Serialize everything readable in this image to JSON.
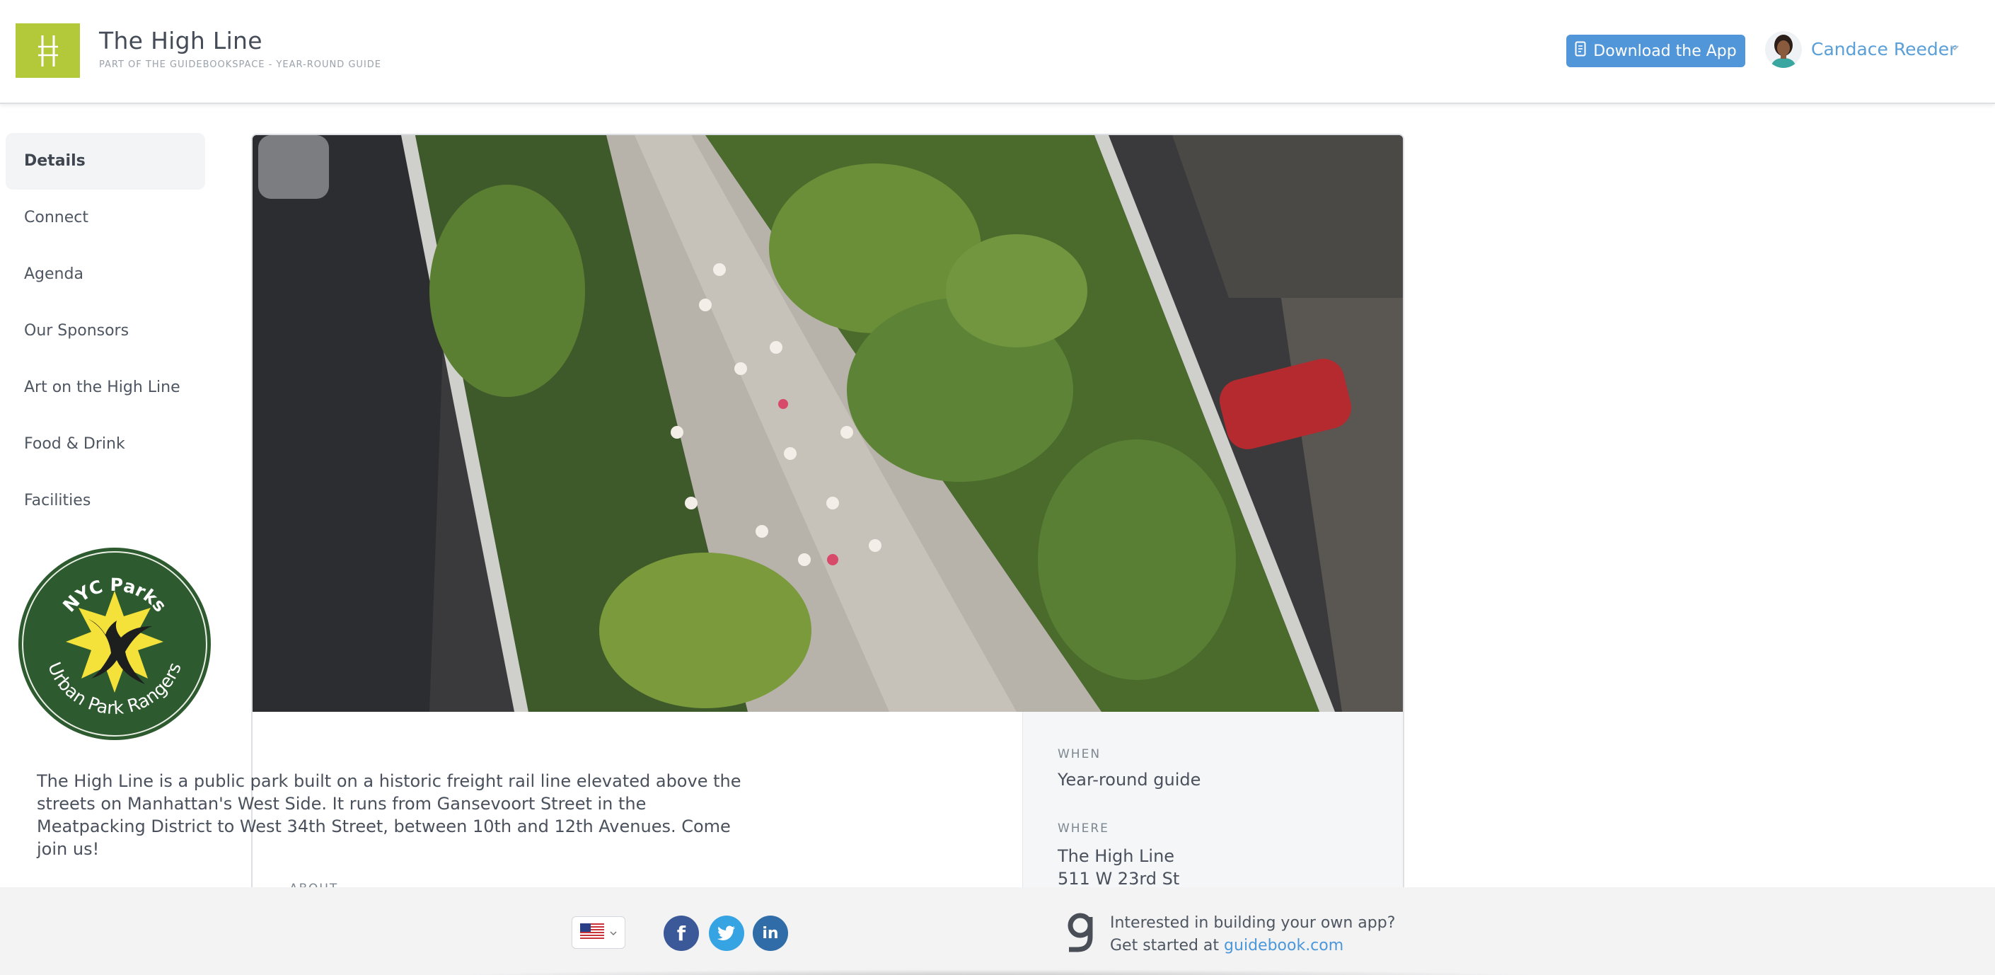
{
  "header": {
    "title": "The High Line",
    "subtitle": "PART OF THE GUIDEBOOKSPACE - YEAR-ROUND GUIDE",
    "download_label": "Download the App",
    "user_name": "Candace Reeder"
  },
  "sidebar": {
    "items": [
      {
        "label": "Details",
        "active": true
      },
      {
        "label": "Connect"
      },
      {
        "label": "Agenda"
      },
      {
        "label": "Our Sponsors"
      },
      {
        "label": "Art on the High Line"
      },
      {
        "label": "Food & Drink"
      },
      {
        "label": "Facilities"
      }
    ],
    "badge": {
      "top_text": "NYC Parks",
      "bottom_text": "Urban Park Rangers"
    }
  },
  "details": {
    "about_label": "ABOUT",
    "about_text": "The High Line is a public park built on a historic freight rail line elevated above the streets on Manhattan's West Side. It runs from Gansevoort Street in the Meatpacking District to West 34th Street, between 10th and 12th Avenues. Come join us!",
    "when_label": "WHEN",
    "when_value": "Year-round guide",
    "where_label": "WHERE",
    "where_name": "The High Line",
    "where_address": "511 W 23rd St"
  },
  "footer": {
    "promo_line1": "Interested in building your own app?",
    "promo_prefix": "Get started at ",
    "promo_link": "guidebook.com"
  },
  "colors": {
    "brand_green": "#b4c93a",
    "accent_blue": "#5096d8",
    "facebook": "#3b5998",
    "twitter": "#36a3e3",
    "linkedin": "#2f6ca8",
    "badge_green": "#2d5b2f",
    "badge_yellow": "#f4e13a"
  },
  "icons": {
    "logo": "high-line-logo-icon",
    "download": "phone-icon",
    "chevron": "chevron-down-icon",
    "flag": "us-flag-icon",
    "facebook": "facebook-icon",
    "twitter": "twitter-icon",
    "linkedin": "linkedin-icon",
    "guidebook": "guidebook-g-icon"
  }
}
